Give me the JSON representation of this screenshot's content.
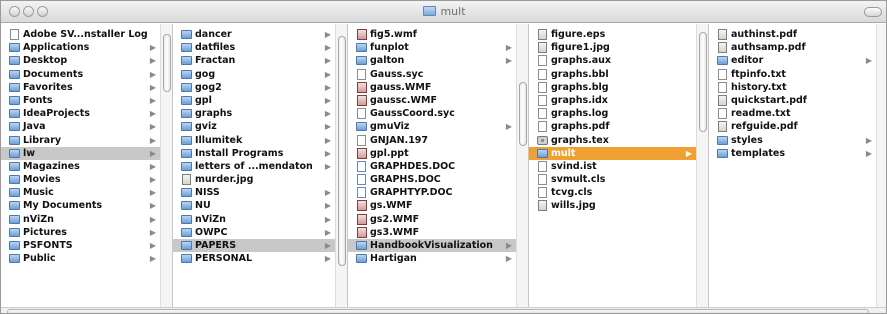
{
  "window": {
    "title": "mult"
  },
  "columns": [
    {
      "items": [
        {
          "label": "Adobe SV...nstaller Log",
          "icon": "file-icon",
          "arrow": false,
          "state": "normal"
        },
        {
          "label": "Applications",
          "icon": "folder-icon",
          "arrow": true,
          "state": "normal"
        },
        {
          "label": "Desktop",
          "icon": "folder-icon",
          "arrow": true,
          "state": "normal"
        },
        {
          "label": "Documents",
          "icon": "folder-icon",
          "arrow": true,
          "state": "normal"
        },
        {
          "label": "Favorites",
          "icon": "folder-icon",
          "arrow": true,
          "state": "normal"
        },
        {
          "label": "Fonts",
          "icon": "folder-icon",
          "arrow": true,
          "state": "normal"
        },
        {
          "label": "IdeaProjects",
          "icon": "folder-icon",
          "arrow": true,
          "state": "normal"
        },
        {
          "label": "Java",
          "icon": "folder-icon",
          "arrow": true,
          "state": "normal"
        },
        {
          "label": "Library",
          "icon": "folder-icon",
          "arrow": true,
          "state": "normal"
        },
        {
          "label": "lw",
          "icon": "folder-icon",
          "arrow": true,
          "state": "selected"
        },
        {
          "label": "Magazines",
          "icon": "folder-icon",
          "arrow": true,
          "state": "normal"
        },
        {
          "label": "Movies",
          "icon": "folder-icon",
          "arrow": true,
          "state": "normal"
        },
        {
          "label": "Music",
          "icon": "folder-icon",
          "arrow": true,
          "state": "normal"
        },
        {
          "label": "My Documents",
          "icon": "folder-icon",
          "arrow": true,
          "state": "normal"
        },
        {
          "label": "nViZn",
          "icon": "folder-icon",
          "arrow": true,
          "state": "normal"
        },
        {
          "label": "Pictures",
          "icon": "folder-icon",
          "arrow": true,
          "state": "normal"
        },
        {
          "label": "PSFONTS",
          "icon": "folder-icon",
          "arrow": true,
          "state": "normal"
        },
        {
          "label": "Public",
          "icon": "folder-icon",
          "arrow": true,
          "state": "normal"
        }
      ]
    },
    {
      "items": [
        {
          "label": "dancer",
          "icon": "folder-icon",
          "arrow": true,
          "state": "normal"
        },
        {
          "label": "datfiles",
          "icon": "folder-icon",
          "arrow": true,
          "state": "normal"
        },
        {
          "label": "Fractan",
          "icon": "folder-icon",
          "arrow": true,
          "state": "normal"
        },
        {
          "label": "gog",
          "icon": "folder-icon",
          "arrow": true,
          "state": "normal"
        },
        {
          "label": "gog2",
          "icon": "folder-icon",
          "arrow": true,
          "state": "normal"
        },
        {
          "label": "gpl",
          "icon": "folder-icon",
          "arrow": true,
          "state": "normal"
        },
        {
          "label": "graphs",
          "icon": "folder-icon",
          "arrow": true,
          "state": "normal"
        },
        {
          "label": "gviz",
          "icon": "folder-icon",
          "arrow": true,
          "state": "normal"
        },
        {
          "label": "Illumitek",
          "icon": "folder-icon",
          "arrow": true,
          "state": "normal"
        },
        {
          "label": "Install Programs",
          "icon": "folder-icon",
          "arrow": true,
          "state": "normal"
        },
        {
          "label": "letters of ...mendaton",
          "icon": "folder-icon",
          "arrow": true,
          "state": "normal"
        },
        {
          "label": "murder.jpg",
          "icon": "image-icon",
          "arrow": false,
          "state": "normal"
        },
        {
          "label": "NISS",
          "icon": "folder-icon",
          "arrow": true,
          "state": "normal"
        },
        {
          "label": "NU",
          "icon": "folder-icon",
          "arrow": true,
          "state": "normal"
        },
        {
          "label": "nViZn",
          "icon": "folder-icon",
          "arrow": true,
          "state": "normal"
        },
        {
          "label": "OWPC",
          "icon": "folder-icon",
          "arrow": true,
          "state": "normal"
        },
        {
          "label": "PAPERS",
          "icon": "folder-icon",
          "arrow": true,
          "state": "selected"
        },
        {
          "label": "PERSONAL",
          "icon": "folder-icon",
          "arrow": true,
          "state": "normal"
        }
      ]
    },
    {
      "items": [
        {
          "label": "fig5.wmf",
          "icon": "wmf-icon",
          "arrow": false,
          "state": "normal"
        },
        {
          "label": "funplot",
          "icon": "folder-icon",
          "arrow": true,
          "state": "normal"
        },
        {
          "label": "galton",
          "icon": "folder-icon",
          "arrow": true,
          "state": "normal"
        },
        {
          "label": "Gauss.syc",
          "icon": "file-icon",
          "arrow": false,
          "state": "normal"
        },
        {
          "label": "gauss.WMF",
          "icon": "wmf-icon",
          "arrow": false,
          "state": "normal"
        },
        {
          "label": "gaussc.WMF",
          "icon": "wmf-icon",
          "arrow": false,
          "state": "normal"
        },
        {
          "label": "GaussCoord.syc",
          "icon": "file-icon",
          "arrow": false,
          "state": "normal"
        },
        {
          "label": "gmuViz",
          "icon": "folder-icon",
          "arrow": true,
          "state": "normal"
        },
        {
          "label": "GNJAN.197",
          "icon": "file-icon",
          "arrow": false,
          "state": "normal"
        },
        {
          "label": "gpl.ppt",
          "icon": "wmf-icon",
          "arrow": false,
          "state": "normal"
        },
        {
          "label": "GRAPHDES.DOC",
          "icon": "doc-icon",
          "arrow": false,
          "state": "normal"
        },
        {
          "label": "GRAPHS.DOC",
          "icon": "doc-icon",
          "arrow": false,
          "state": "normal"
        },
        {
          "label": "GRAPHTYP.DOC",
          "icon": "doc-icon",
          "arrow": false,
          "state": "normal"
        },
        {
          "label": "gs.WMF",
          "icon": "wmf-icon",
          "arrow": false,
          "state": "normal"
        },
        {
          "label": "gs2.WMF",
          "icon": "wmf-icon",
          "arrow": false,
          "state": "normal"
        },
        {
          "label": "gs3.WMF",
          "icon": "wmf-icon",
          "arrow": false,
          "state": "normal"
        },
        {
          "label": "HandbookVisualization",
          "icon": "folder-icon",
          "arrow": true,
          "state": "selected"
        },
        {
          "label": "Hartigan",
          "icon": "folder-icon",
          "arrow": true,
          "state": "normal"
        }
      ]
    },
    {
      "items": [
        {
          "label": "figure.eps",
          "icon": "image-icon",
          "arrow": false,
          "state": "normal"
        },
        {
          "label": "figure1.jpg",
          "icon": "image-icon",
          "arrow": false,
          "state": "normal"
        },
        {
          "label": "graphs.aux",
          "icon": "file-icon",
          "arrow": false,
          "state": "normal"
        },
        {
          "label": "graphs.bbl",
          "icon": "file-icon",
          "arrow": false,
          "state": "normal"
        },
        {
          "label": "graphs.blg",
          "icon": "file-icon",
          "arrow": false,
          "state": "normal"
        },
        {
          "label": "graphs.idx",
          "icon": "file-icon",
          "arrow": false,
          "state": "normal"
        },
        {
          "label": "graphs.log",
          "icon": "file-icon",
          "arrow": false,
          "state": "normal"
        },
        {
          "label": "graphs.pdf",
          "icon": "file-icon",
          "arrow": false,
          "state": "normal"
        },
        {
          "label": "graphs.tex",
          "icon": "gear-icon",
          "arrow": false,
          "state": "normal"
        },
        {
          "label": "mult",
          "icon": "folder-icon",
          "arrow": true,
          "state": "active"
        },
        {
          "label": "svind.ist",
          "icon": "file-icon",
          "arrow": false,
          "state": "normal"
        },
        {
          "label": "svmult.cls",
          "icon": "file-icon",
          "arrow": false,
          "state": "normal"
        },
        {
          "label": "tcvg.cls",
          "icon": "file-icon",
          "arrow": false,
          "state": "normal"
        },
        {
          "label": "wills.jpg",
          "icon": "image-icon",
          "arrow": false,
          "state": "normal"
        }
      ]
    },
    {
      "items": [
        {
          "label": "authinst.pdf",
          "icon": "image-icon",
          "arrow": false,
          "state": "normal"
        },
        {
          "label": "authsamp.pdf",
          "icon": "image-icon",
          "arrow": false,
          "state": "normal"
        },
        {
          "label": "editor",
          "icon": "folder-icon",
          "arrow": true,
          "state": "normal"
        },
        {
          "label": "ftpinfo.txt",
          "icon": "file-icon",
          "arrow": false,
          "state": "normal"
        },
        {
          "label": "history.txt",
          "icon": "file-icon",
          "arrow": false,
          "state": "normal"
        },
        {
          "label": "quickstart.pdf",
          "icon": "image-icon",
          "arrow": false,
          "state": "normal"
        },
        {
          "label": "readme.txt",
          "icon": "file-icon",
          "arrow": false,
          "state": "normal"
        },
        {
          "label": "refguide.pdf",
          "icon": "image-icon",
          "arrow": false,
          "state": "normal"
        },
        {
          "label": "styles",
          "icon": "folder-icon",
          "arrow": true,
          "state": "normal"
        },
        {
          "label": "templates",
          "icon": "folder-icon",
          "arrow": true,
          "state": "normal"
        }
      ]
    }
  ],
  "arrow_glyph": "▶",
  "colors": {
    "selection_active": "#f0a030",
    "selection_inactive": "#c8c8c8"
  }
}
